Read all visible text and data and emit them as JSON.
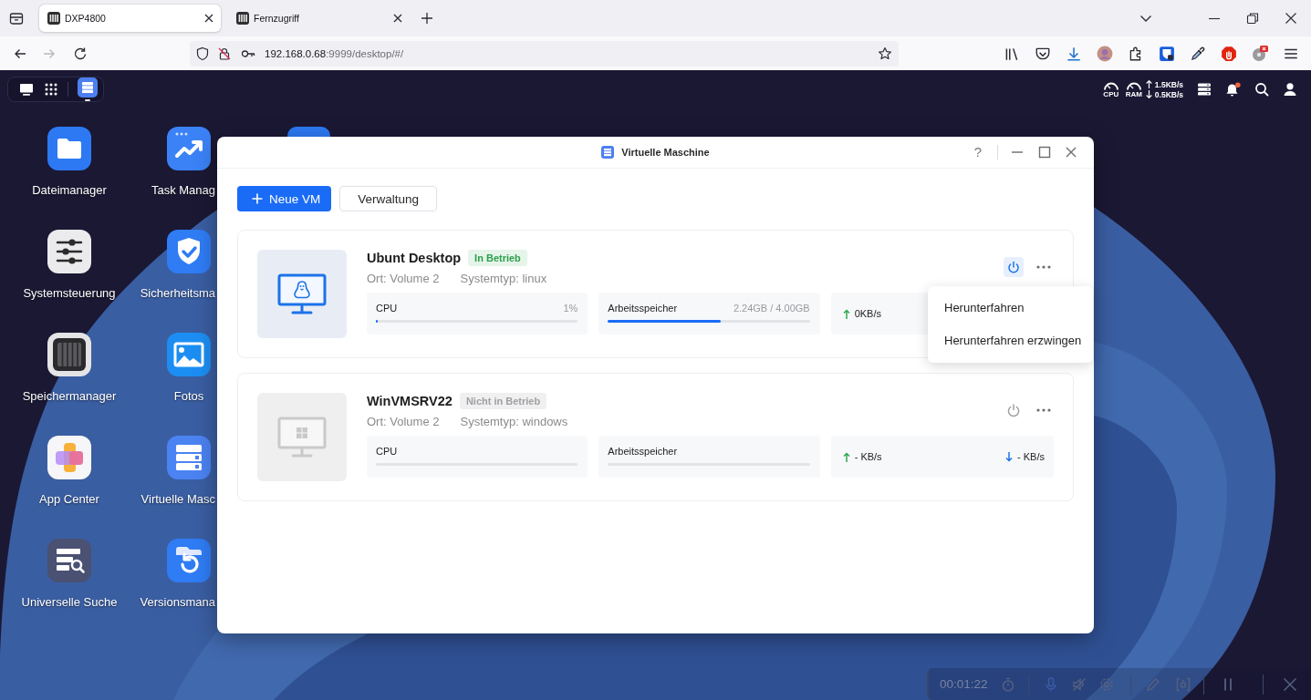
{
  "browser": {
    "tabs": [
      {
        "title": "DXP4800",
        "selected": true
      },
      {
        "title": "Fernzugriff",
        "selected": false
      }
    ],
    "nav_buttons": [
      {
        "kind": "back",
        "disabled": false
      },
      {
        "kind": "forward",
        "disabled": true
      },
      {
        "kind": "reload",
        "disabled": false
      }
    ],
    "address": {
      "host": "192.168.0.68",
      "path": ":9999/desktop/#/"
    }
  },
  "desktop": {
    "status": {
      "gauges": [
        "CPU",
        "RAM"
      ],
      "upload": "1.5KB/s",
      "download": "0.5KB/s",
      "notification": true
    },
    "icons": [
      {
        "kind": "files",
        "label": "Dateimanager"
      },
      {
        "kind": "tasks",
        "label": "Task Manag"
      },
      {
        "kind": "settings",
        "label": "Systemsteuerung"
      },
      {
        "kind": "security",
        "label": "Sicherheitsma"
      },
      {
        "kind": "storage",
        "label": "Speichermanager"
      },
      {
        "kind": "photos",
        "label": "Fotos"
      },
      {
        "kind": "apps",
        "label": "App Center"
      },
      {
        "kind": "vm",
        "label": "Virtuelle Masc"
      },
      {
        "kind": "search",
        "label": "Universelle Suche"
      },
      {
        "kind": "versions",
        "label": "Versionsmana"
      }
    ]
  },
  "window": {
    "title": "Virtuelle Maschine",
    "help": "?",
    "buttons": [
      {
        "kind": "primary",
        "label": "Neue VM"
      },
      {
        "kind": "secondary",
        "label": "Verwaltung"
      }
    ],
    "vms": [
      {
        "kind": "linux",
        "name": "Ubunt Desktop",
        "status": {
          "kind": "running",
          "label": "In Betrieb"
        },
        "location": "Ort: Volume 2",
        "system_type": "Systemtyp: linux",
        "metrics": [
          {
            "label": "CPU",
            "reading": "1%",
            "level": 0.01
          },
          {
            "label": "Arbeitsspeicher",
            "reading": "2.24GB / 4.00GB",
            "level": 0.56
          }
        ],
        "network": {
          "upload": "0KB/s"
        },
        "menu": [
          "Herunterfahren",
          "Herunterfahren erzwingen"
        ]
      },
      {
        "kind": "windows",
        "name": "WinVMSRV22",
        "status": {
          "kind": "stopped",
          "label": "Nicht in Betrieb"
        },
        "location": "Ort: Volume 2",
        "system_type": "Systemtyp: windows",
        "metrics": [
          {
            "label": "CPU"
          },
          {
            "label": "Arbeitsspeicher"
          }
        ],
        "network": {
          "upload": "- KB/s",
          "download": "- KB/s"
        }
      }
    ]
  },
  "recording_bar": {
    "time": "00:01:22"
  }
}
